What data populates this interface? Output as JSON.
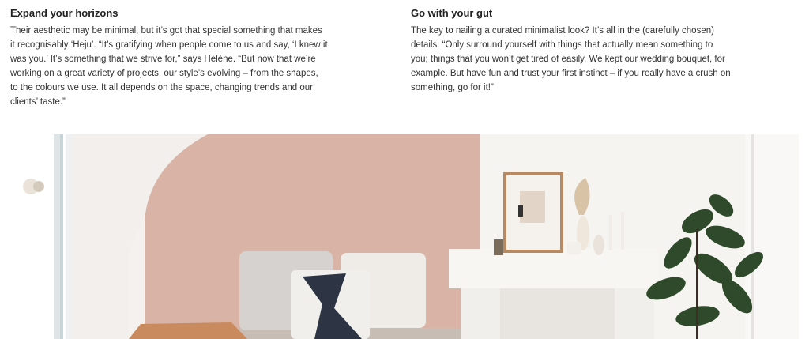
{
  "sections": [
    {
      "heading": "Expand your horizons",
      "body": "Their aesthetic may be minimal, but it’s got that special something that makes it recognisably ‘Heju’. “It’s gratifying when people come to us and say, ‘I knew it was you.’ It’s something that we strive for,” says Hélène. “But now that we’re working on a great variety of projects, our style’s evolving – from the shapes, to the colours we use. It all depends on the space, changing trends and our clients’ taste.”"
    },
    {
      "heading": "Go with your gut",
      "body": "The key to nailing a curated minimalist look? It’s all in the (carefully chosen) details. “Only surround yourself with things that actually mean something to you; things that you won’t get tired of easily. We kept our wedding bouquet, for example. But have fun and trust your first instinct – if you really have a crush on something, go for it!”"
    }
  ],
  "photo": {
    "colors": {
      "wall_pink": "#d9b4a6",
      "wall_white": "#f4f1ee",
      "fireplace": "#f7f6f3",
      "plant": "#2f4a2a",
      "pillow_navy": "#2d3545",
      "blanket": "#c98a5e"
    }
  }
}
